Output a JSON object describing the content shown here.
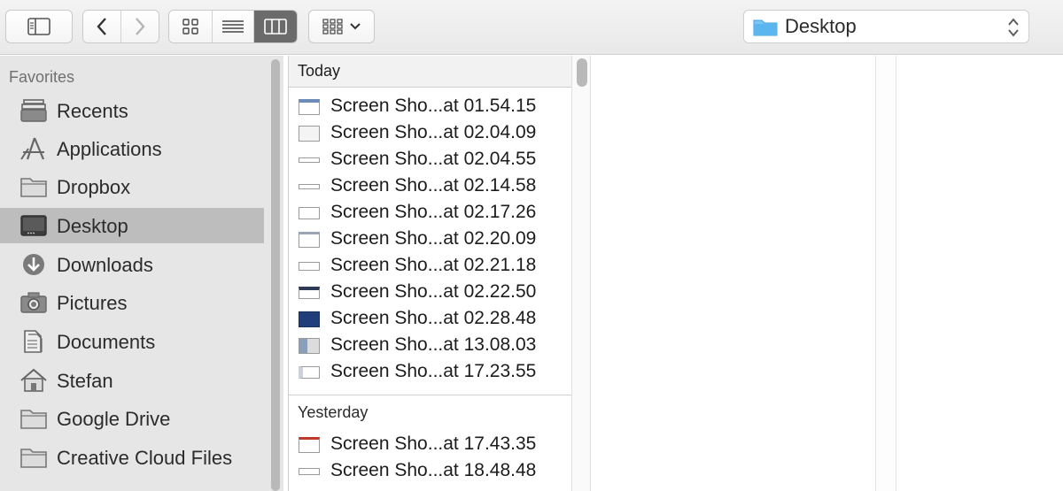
{
  "toolbar": {
    "path_label": "Desktop"
  },
  "sidebar": {
    "header": "Favorites",
    "items": [
      {
        "label": "Recents",
        "icon": "recents-icon",
        "selected": false
      },
      {
        "label": "Applications",
        "icon": "applications-icon",
        "selected": false
      },
      {
        "label": "Dropbox",
        "icon": "folder-icon",
        "selected": false
      },
      {
        "label": "Desktop",
        "icon": "desktop-icon",
        "selected": true
      },
      {
        "label": "Downloads",
        "icon": "downloads-icon",
        "selected": false
      },
      {
        "label": "Pictures",
        "icon": "camera-icon",
        "selected": false
      },
      {
        "label": "Documents",
        "icon": "documents-icon",
        "selected": false
      },
      {
        "label": "Stefan",
        "icon": "home-icon",
        "selected": false
      },
      {
        "label": "Google Drive",
        "icon": "folder-icon",
        "selected": false
      },
      {
        "label": "Creative Cloud Files",
        "icon": "folder-icon",
        "selected": false
      }
    ]
  },
  "files": {
    "today_header": "Today",
    "today": [
      "Screen Sho...at 01.54.15",
      "Screen Sho...at 02.04.09",
      "Screen Sho...at 02.04.55",
      "Screen Sho...at 02.14.58",
      "Screen Sho...at 02.17.26",
      "Screen Sho...at 02.20.09",
      "Screen Sho...at 02.21.18",
      "Screen Sho...at 02.22.50",
      "Screen Sho...at 02.28.48",
      "Screen Sho...at 13.08.03",
      "Screen Sho...at 17.23.55"
    ],
    "yesterday_header": "Yesterday",
    "yesterday": [
      "Screen Sho...at 17.43.35",
      "Screen Sho...at 18.48.48"
    ]
  },
  "colors": {
    "selection": "#bdbdbd",
    "sidebar_bg": "#e6e6e6",
    "active_view": "#6b6b6b",
    "folder_blue": "#5bb6f0"
  }
}
